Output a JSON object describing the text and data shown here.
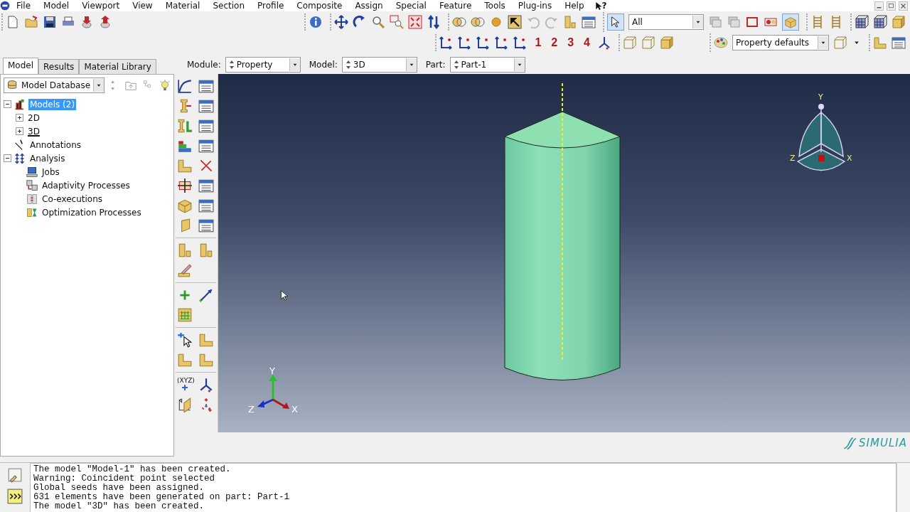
{
  "menu_bar": {
    "items": [
      "File",
      "Model",
      "Viewport",
      "View",
      "Material",
      "Section",
      "Profile",
      "Composite",
      "Assign",
      "Special",
      "Feature",
      "Tools",
      "Plug-ins",
      "Help"
    ],
    "whats_this": "?"
  },
  "toolbar": {
    "selection_filter": "All",
    "view_numbers": [
      "1",
      "2",
      "3",
      "4"
    ],
    "render_style": "Property defaults"
  },
  "tabs": [
    {
      "label": "Model",
      "selected": true
    },
    {
      "label": "Results",
      "selected": false
    },
    {
      "label": "Material Library",
      "selected": false
    }
  ],
  "tree_source": "Model Database",
  "tree": [
    {
      "label": "Models (2)",
      "selected": true,
      "expanded": true,
      "children": [
        {
          "label": "2D",
          "selected": false,
          "expanded": false
        },
        {
          "label": "3D",
          "selected": false,
          "expanded": false,
          "current": true
        }
      ]
    },
    {
      "label": "Annotations",
      "selected": false
    },
    {
      "label": "Analysis",
      "selected": false,
      "expanded": true,
      "children": [
        {
          "label": "Jobs",
          "selected": false
        },
        {
          "label": "Adaptivity Processes",
          "selected": false
        },
        {
          "label": "Co-executions",
          "selected": false
        },
        {
          "label": "Optimization Processes",
          "selected": false
        }
      ]
    }
  ],
  "context_bar": [
    {
      "label": "Module:",
      "value": "Property"
    },
    {
      "label": "Model:",
      "value": "3D"
    },
    {
      "label": "Part:",
      "value": "Part-1"
    }
  ],
  "toolbox": {
    "csys_label": "(XYZ)"
  },
  "viewport": {
    "triad_labels": [
      "Y",
      "Z",
      "X"
    ],
    "view_cube_labels": [
      "Y",
      "Z",
      "X"
    ]
  },
  "brand": "SIMULIA",
  "messages": [
    "The model \"Model-1\" has been created.",
    "Warning: Coincident point selected",
    "Global seeds have been assigned.",
    "631 elements have been generated on part: Part-1",
    "The model \"3D\" has been created."
  ]
}
